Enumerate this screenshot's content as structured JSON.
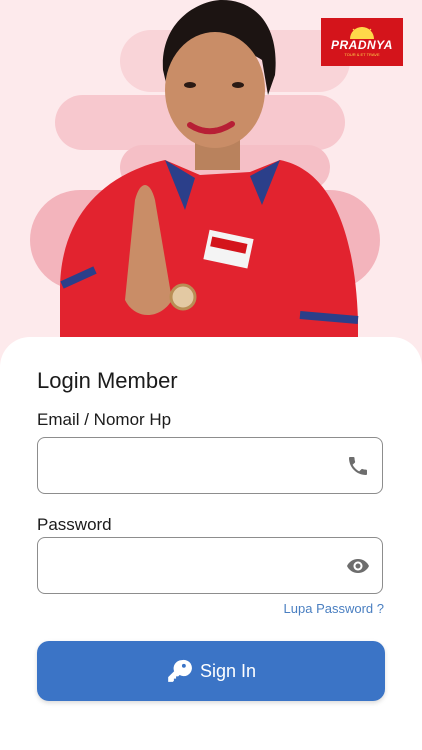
{
  "brand": {
    "name": "PRADNYA",
    "tagline": "TOUR & ET TRAVE",
    "color": "#d4141b"
  },
  "form": {
    "title": "Login Member",
    "email_label": "Email / Nomor Hp",
    "email_value": "",
    "email_icon": "phone-icon",
    "password_label": "Password",
    "password_value": "",
    "password_icon": "eye-icon",
    "forgot_link": "Lupa Password ?",
    "submit_label": "Sign In",
    "submit_icon": "key-icon",
    "accent_color": "#3b74c6"
  }
}
